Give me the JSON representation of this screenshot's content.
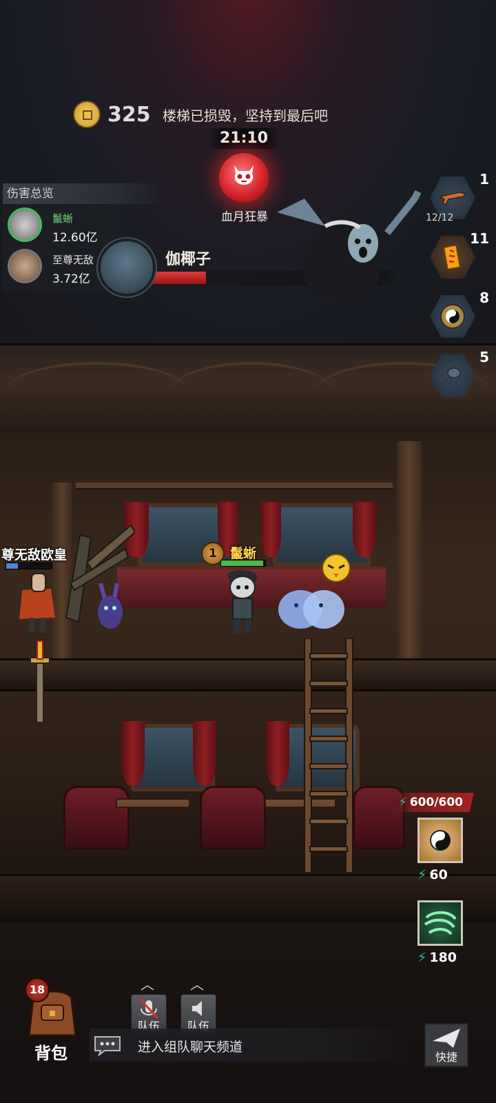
{
  "hud": {
    "coins": "325",
    "notice": "楼梯已损毁，坚持到最后吧",
    "timer": "21:10",
    "event_label": "血月狂暴"
  },
  "damage_panel": {
    "title": "伤害总览",
    "rows": [
      {
        "name": "鬣蜥",
        "value": "12.60亿"
      },
      {
        "name": "至尊无敌",
        "value": "3.72亿"
      }
    ]
  },
  "boss": {
    "name": "伽椰子",
    "hp_fraction": 0.24
  },
  "items": [
    {
      "icon": "rifle-icon",
      "count": "1",
      "sub": "12/12"
    },
    {
      "icon": "talisman-icon",
      "count": "11",
      "sub": ""
    },
    {
      "icon": "yin-yang-compass-icon",
      "count": "8",
      "sub": ""
    },
    {
      "icon": "spider-icon",
      "count": "5",
      "sub": ""
    }
  ],
  "players": {
    "ally": {
      "name": "尊无敌欧皇",
      "hp_fraction": 0.25,
      "hp_color": "#4a86d6"
    },
    "self": {
      "name": "鬣蜥",
      "level": "1",
      "hp_fraction": 0.95,
      "hp_color": "#4fb84a"
    }
  },
  "skills": {
    "energy": "600/600",
    "list": [
      {
        "icon": "bagua-skill-icon",
        "cost": "60"
      },
      {
        "icon": "whirlwind-skill-icon",
        "cost": "180"
      }
    ]
  },
  "bottom": {
    "bag_label": "背包",
    "bag_count": "18",
    "team_mic_label": "队伍",
    "team_speaker_label": "队伍",
    "chat_prompt": "进入组队聊天频道",
    "shortcut_label": "快捷"
  },
  "colors": {
    "accent_red": "#d4252a",
    "name_gold": "#ffd34d",
    "energy_teal": "#2ec1a8"
  }
}
